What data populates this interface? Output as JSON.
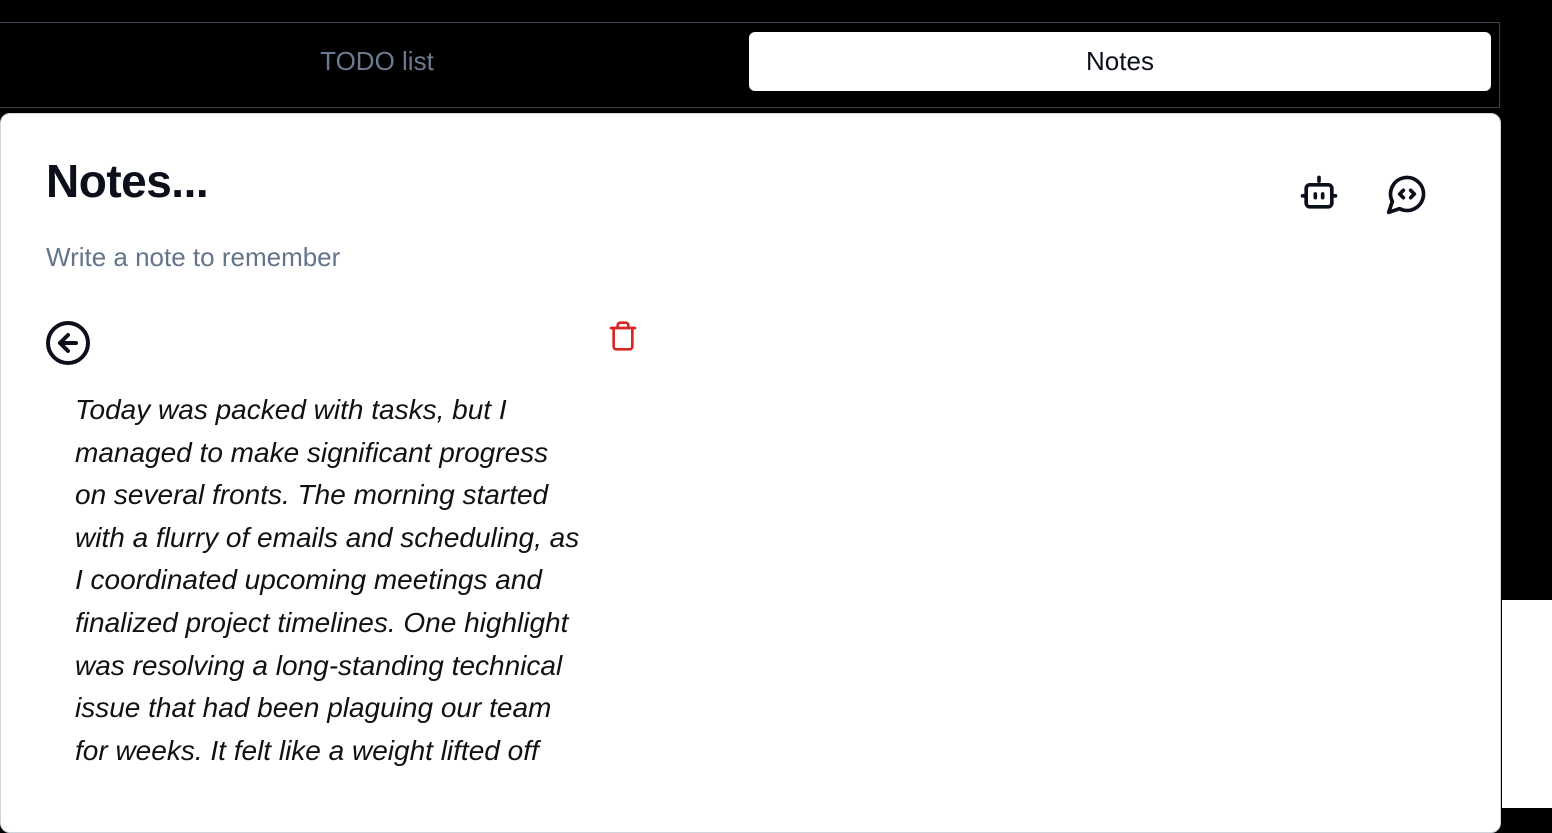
{
  "tabs": [
    {
      "label": "TODO list",
      "active": false
    },
    {
      "label": "Notes",
      "active": true
    }
  ],
  "page": {
    "title": "Notes...",
    "subtitle": "Write a note to remember"
  },
  "icons": {
    "bot": "bot-icon",
    "chat": "message-code-icon",
    "back": "arrow-left-circle-icon",
    "trash": "trash-icon"
  },
  "colors": {
    "trash": "#dc2626",
    "muted_text": "#64748b",
    "active_tab_bg": "#ffffff"
  },
  "note": {
    "text": "Today was packed with tasks, but I\nmanaged to make significant progress\non several fronts. The morning started\nwith a flurry of emails and scheduling, as\nI coordinated upcoming meetings and\nfinalized project timelines. One highlight\nwas resolving a long-standing technical\nissue that had been plaguing our team\nfor weeks. It felt like a weight lifted off"
  }
}
